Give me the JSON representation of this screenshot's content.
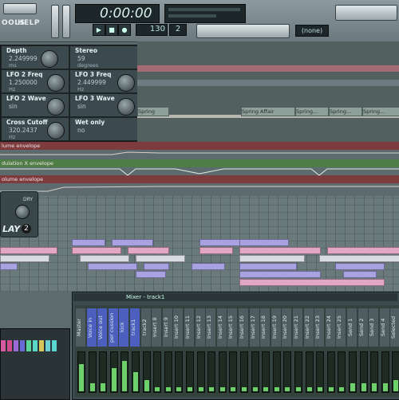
{
  "toolbar": {
    "menu_tools": "OOLS",
    "menu_help": "HELP",
    "time_display": "0:00:00",
    "tempo": "130",
    "pattern_num": "2",
    "snap": "(none)"
  },
  "plugin": {
    "params": [
      {
        "label": "Depth",
        "value": "2.249999",
        "unit": "ms"
      },
      {
        "label": "Stereo",
        "value": "59",
        "unit": "degrees"
      },
      {
        "label": "LFO 2 Freq",
        "value": "1.250000",
        "unit": "Hz"
      },
      {
        "label": "LFO 3 Freq",
        "value": "2.449999",
        "unit": "Hz"
      },
      {
        "label": "LFO 2 Wave",
        "value": "sin",
        "unit": ""
      },
      {
        "label": "LFO 3 Wave",
        "value": "sin",
        "unit": ""
      },
      {
        "label": "Cross Cutoff",
        "value": "320.2437",
        "unit": "Hz"
      },
      {
        "label": "Wet only",
        "value": "no",
        "unit": ""
      }
    ]
  },
  "playlist": {
    "patterns": [
      "Spring",
      "Spring Affair",
      "Spring...",
      "Spring...",
      "Spring..."
    ]
  },
  "envelopes": {
    "env1": "lume envelope",
    "env2": "dulation X envelope",
    "env3": "olume envelope"
  },
  "delay_plugin": {
    "label": "LAY",
    "badge": "2",
    "knob_label": "DRY"
  },
  "mixer": {
    "title": "Mixer - track1",
    "channels": [
      "Master",
      "Voice in",
      "Voice out",
      "per cussion",
      "kick",
      "track1",
      "track2",
      "Insert 8",
      "Insert 9",
      "Insert 10",
      "Insert 11",
      "Insert 12",
      "Insert 13",
      "Insert 14",
      "Insert 15",
      "Insert 16",
      "Insert 17",
      "Insert 18",
      "Insert 19",
      "Insert 20",
      "Insert 21",
      "Insert 22",
      "Insert 23",
      "Insert 24",
      "Insert 25",
      "Send 1",
      "Send 2",
      "Send 3",
      "Send 4",
      "Selected"
    ],
    "meter_levels": [
      0.7,
      0.2,
      0.2,
      0.6,
      0.8,
      0.5,
      0.3,
      0.1,
      0.1,
      0.1,
      0.1,
      0.1,
      0.1,
      0.1,
      0.1,
      0.1,
      0.1,
      0.1,
      0.1,
      0.1,
      0.1,
      0.1,
      0.1,
      0.1,
      0.1,
      0.2,
      0.2,
      0.2,
      0.2,
      0.3
    ]
  },
  "colors": {
    "accent_blue": "#4c5fbf",
    "note_pink": "#e2a7c4",
    "note_lavender": "#a9a2e0",
    "note_white": "#d9dbe0",
    "envelope_red": "#8c3c3c",
    "envelope_green": "#5c8c4e"
  }
}
